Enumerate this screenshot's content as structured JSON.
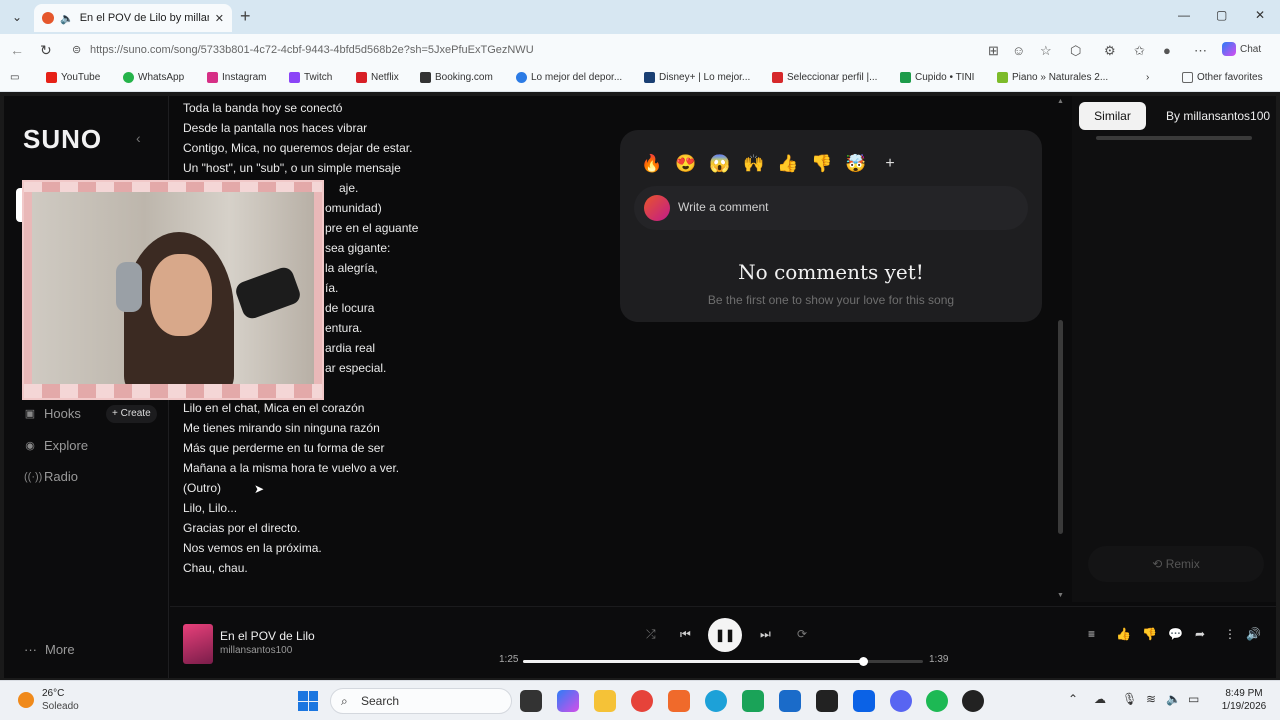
{
  "browser": {
    "tab_title": "En el POV de Lilo by millansan",
    "url": "https://suno.com/song/5733b801-4c72-4cbf-9443-4bfd5d568b2e?sh=5JxePfuExTGezNWU",
    "chat_label": "Chat",
    "bookmarks": [
      "YouTube",
      "WhatsApp",
      "Instagram",
      "Twitch",
      "Netflix",
      "Booking.com",
      "Lo mejor del depor...",
      "Disney+ | Lo mejor...",
      "Seleccionar perfil |...",
      "Cupido • TINI",
      "Piano » Naturales 2...",
      "Other favorites"
    ]
  },
  "sidebar": {
    "logo": "SUNO",
    "nav": [
      {
        "label": "Hooks",
        "icon": "hooks-icon"
      },
      {
        "label": "Explore",
        "icon": "explore-icon"
      },
      {
        "label": "Radio",
        "icon": "radio-icon"
      }
    ],
    "create_label": "+ Create",
    "more_label": "More"
  },
  "lyrics": [
    "Toda la banda hoy se conectó",
    "Desde la pantalla nos haces vibrar",
    "Contigo, Mica, no queremos dejar de estar.",
    "Un \"host\", un \"sub\", o un simple mensaje",
    "aje.",
    "omunidad)",
    "pre en el aguante",
    "sea gigante:",
    "la alegría,",
    "ía.",
    "de locura",
    "entura.",
    "ardia real",
    "ar especial.",
    "",
    "Lilo en el chat, Mica en el corazón",
    "Me tienes mirando sin ninguna razón",
    "Más que perderme en tu forma de ser",
    "Mañana a la misma hora te vuelvo a ver.",
    "(Outro)",
    "Lilo, Lilo...",
    "Gracias por el directo.",
    "Nos vemos en la próxima.",
    "Chau, chau."
  ],
  "comments": {
    "reactions": [
      "🔥",
      "😍",
      "😱",
      "🙌",
      "👍",
      "👎",
      "🤯",
      "+"
    ],
    "placeholder": "Write a comment",
    "empty_title": "No comments yet!",
    "empty_sub": "Be the first one to show your love for this song"
  },
  "right_panel": {
    "tab_similar": "Similar",
    "tab_by": "By millansantos100",
    "remix_label": "Remix"
  },
  "player": {
    "title": "En el POV de Lilo",
    "artist": "millansantos100",
    "elapsed": "1:25",
    "remaining": "1:39",
    "progress_fraction": 0.85
  },
  "taskbar": {
    "temp": "26°C",
    "condition": "Soleado",
    "search_label": "Search",
    "time": "8:49 PM",
    "date": "1/19/2026"
  }
}
